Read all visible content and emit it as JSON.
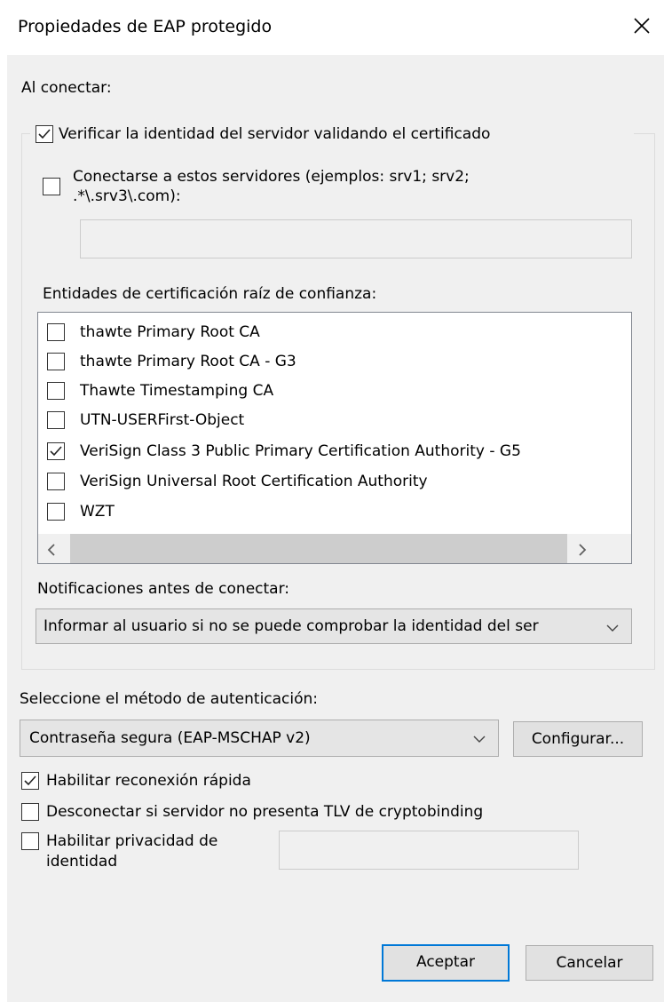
{
  "window": {
    "title": "Propiedades de EAP protegido"
  },
  "on_connect": {
    "heading": "Al conectar:",
    "verify_server": {
      "label": "Verificar la identidad del servidor validando el certificado",
      "checked": true
    },
    "connect_servers": {
      "label_line1": "Conectarse a estos servidores (ejemplos: srv1; srv2;",
      "label_line2": ".*\\.srv3\\.com):",
      "checked": false,
      "value": ""
    },
    "trusted_ca_label": "Entidades de certificación raíz de confianza:",
    "trusted_ca_items": [
      {
        "label": "thawte Primary Root CA",
        "checked": false
      },
      {
        "label": "thawte Primary Root CA - G3",
        "checked": false
      },
      {
        "label": "Thawte Timestamping CA",
        "checked": false
      },
      {
        "label": "UTN-USERFirst-Object",
        "checked": false
      },
      {
        "label": "VeriSign Class 3 Public Primary Certification Authority - G5",
        "checked": true
      },
      {
        "label": "VeriSign Universal Root Certification Authority",
        "checked": false
      },
      {
        "label": "WZT",
        "checked": false
      }
    ],
    "notifications_label": "Notificaciones antes de conectar:",
    "notifications_value": "Informar al usuario si no se puede comprobar la identidad del ser"
  },
  "auth": {
    "method_label": "Seleccione el método de autenticación:",
    "method_value": "Contraseña segura (EAP-MSCHAP v2)",
    "configure_button": "Configurar...",
    "fast_reconnect": {
      "label": "Habilitar reconexión rápida",
      "checked": true
    },
    "disconnect_tlv": {
      "label": "Desconectar si servidor no presenta TLV de cryptobinding",
      "checked": false
    },
    "identity_privacy": {
      "label_line1": "Habilitar privacidad de",
      "label_line2": "identidad",
      "checked": false,
      "value": ""
    }
  },
  "buttons": {
    "ok": "Aceptar",
    "cancel": "Cancelar"
  }
}
